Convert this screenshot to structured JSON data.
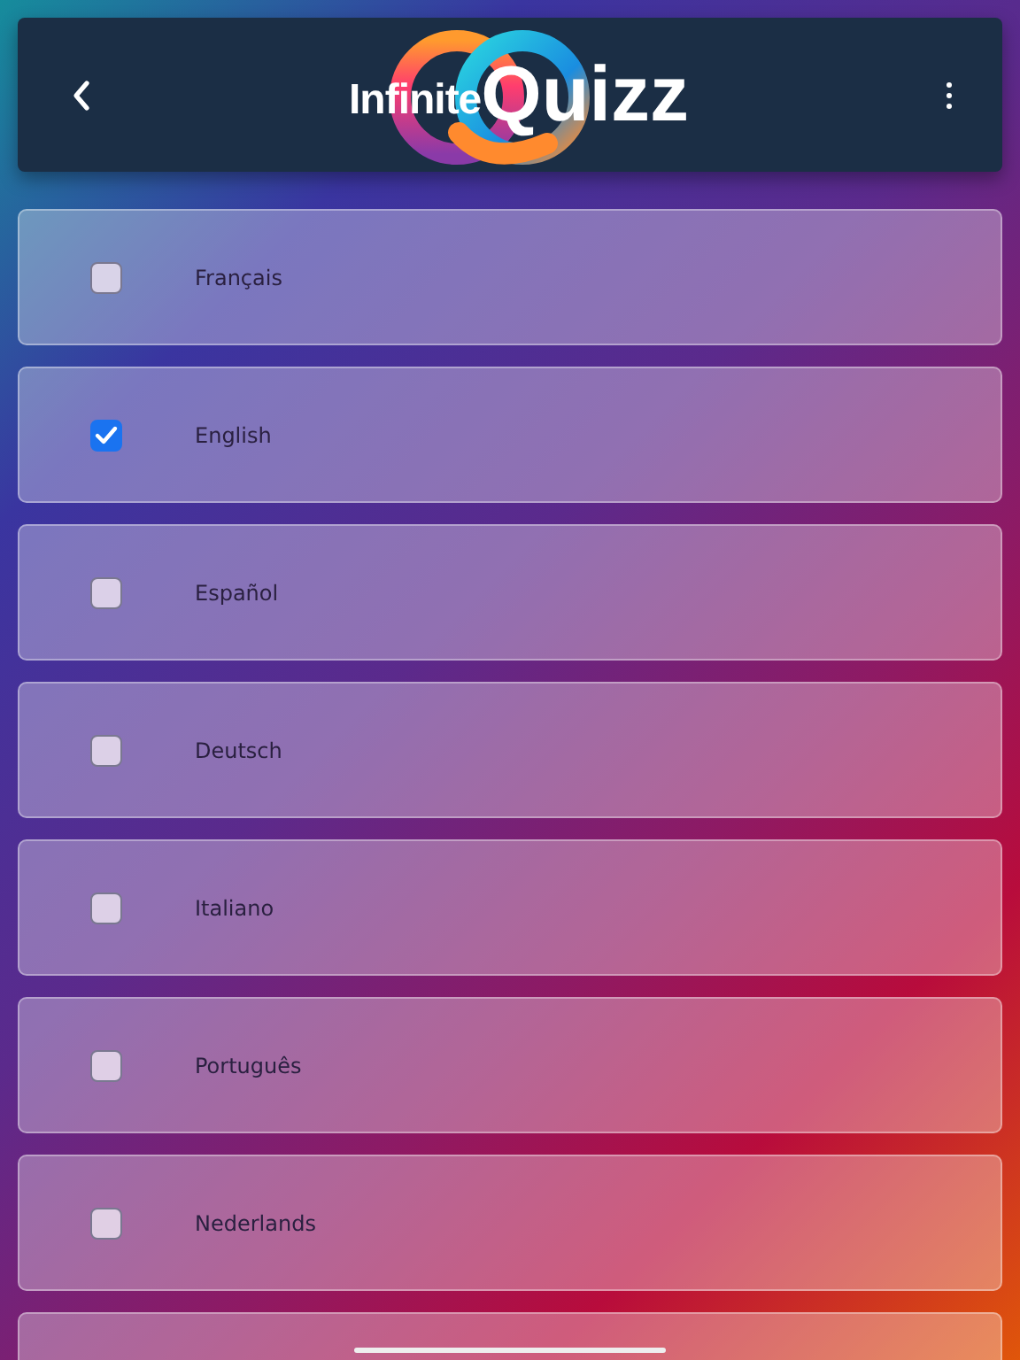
{
  "header": {
    "logo_word_1": "Infinite",
    "logo_word_2": "Quizz"
  },
  "languages": [
    {
      "label": "Français",
      "checked": false
    },
    {
      "label": "English",
      "checked": true
    },
    {
      "label": "Español",
      "checked": false
    },
    {
      "label": "Deutsch",
      "checked": false
    },
    {
      "label": "Italiano",
      "checked": false
    },
    {
      "label": "Português",
      "checked": false
    },
    {
      "label": "Nederlands",
      "checked": false
    }
  ]
}
